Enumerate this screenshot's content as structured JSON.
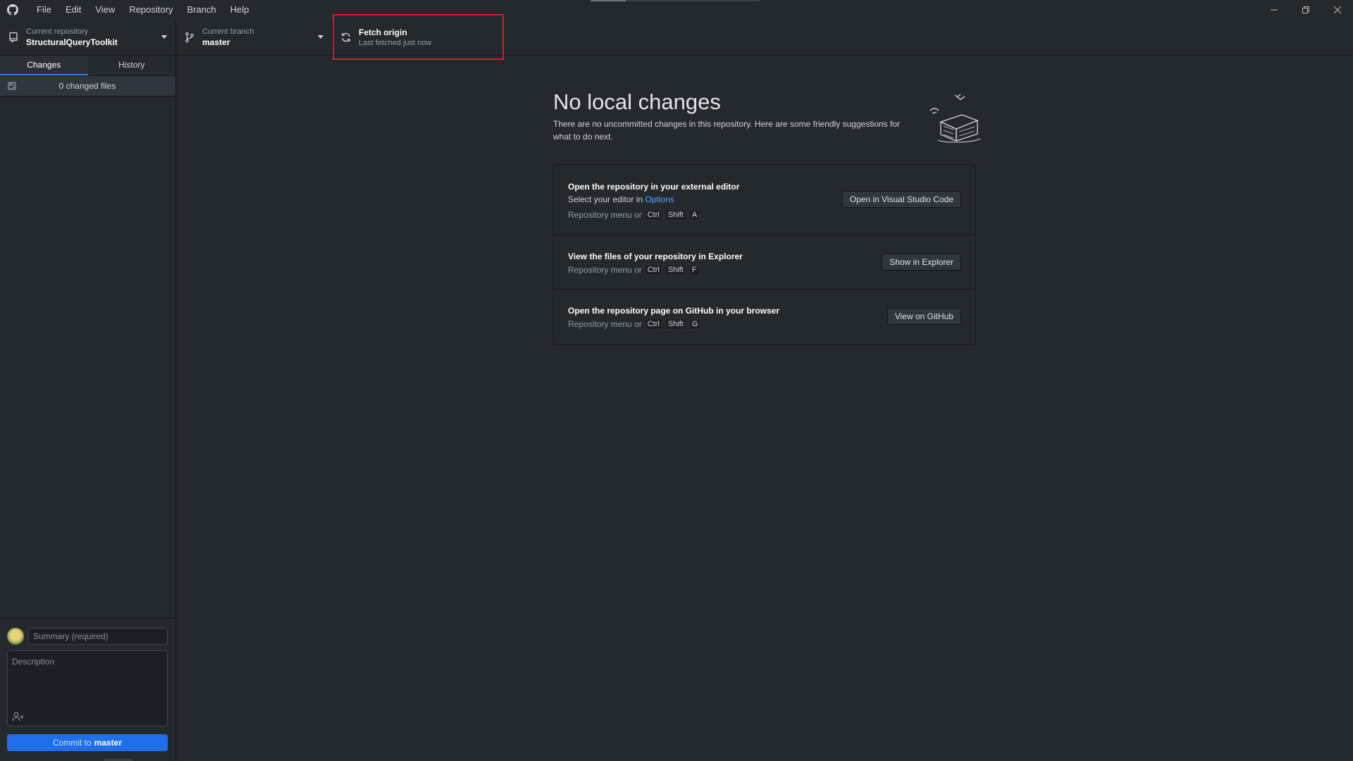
{
  "menu": [
    "File",
    "Edit",
    "View",
    "Repository",
    "Branch",
    "Help"
  ],
  "toolbar": {
    "repo": {
      "label": "Current repository",
      "value": "StructuralQueryToolkit"
    },
    "branch": {
      "label": "Current branch",
      "value": "master"
    },
    "fetch": {
      "label": "Fetch origin",
      "sub": "Last fetched just now"
    }
  },
  "sidebar": {
    "tabs": [
      "Changes",
      "History"
    ],
    "changed_files": "0 changed files",
    "summary_placeholder": "Summary (required)",
    "description_placeholder": "Description",
    "commit_prefix": "Commit to",
    "commit_branch": "master"
  },
  "main": {
    "title": "No local changes",
    "description": "There are no uncommitted changes in this repository. Here are some friendly suggestions for what to do next.",
    "actions": [
      {
        "title": "Open the repository in your external editor",
        "sub_prefix": "Select your editor in",
        "sub_link": "Options",
        "hint": "Repository menu or",
        "keys": [
          "Ctrl",
          "Shift",
          "A"
        ],
        "button": "Open in Visual Studio Code"
      },
      {
        "title": "View the files of your repository in Explorer",
        "hint": "Repository menu or",
        "keys": [
          "Ctrl",
          "Shift",
          "F"
        ],
        "button": "Show in Explorer"
      },
      {
        "title": "Open the repository page on GitHub in your browser",
        "hint": "Repository menu or",
        "keys": [
          "Ctrl",
          "Shift",
          "G"
        ],
        "button": "View on GitHub"
      }
    ]
  },
  "colors": {
    "accent": "#1f6feb",
    "link": "#58a6ff",
    "highlight": "#e3142b",
    "background": "#24292e"
  }
}
